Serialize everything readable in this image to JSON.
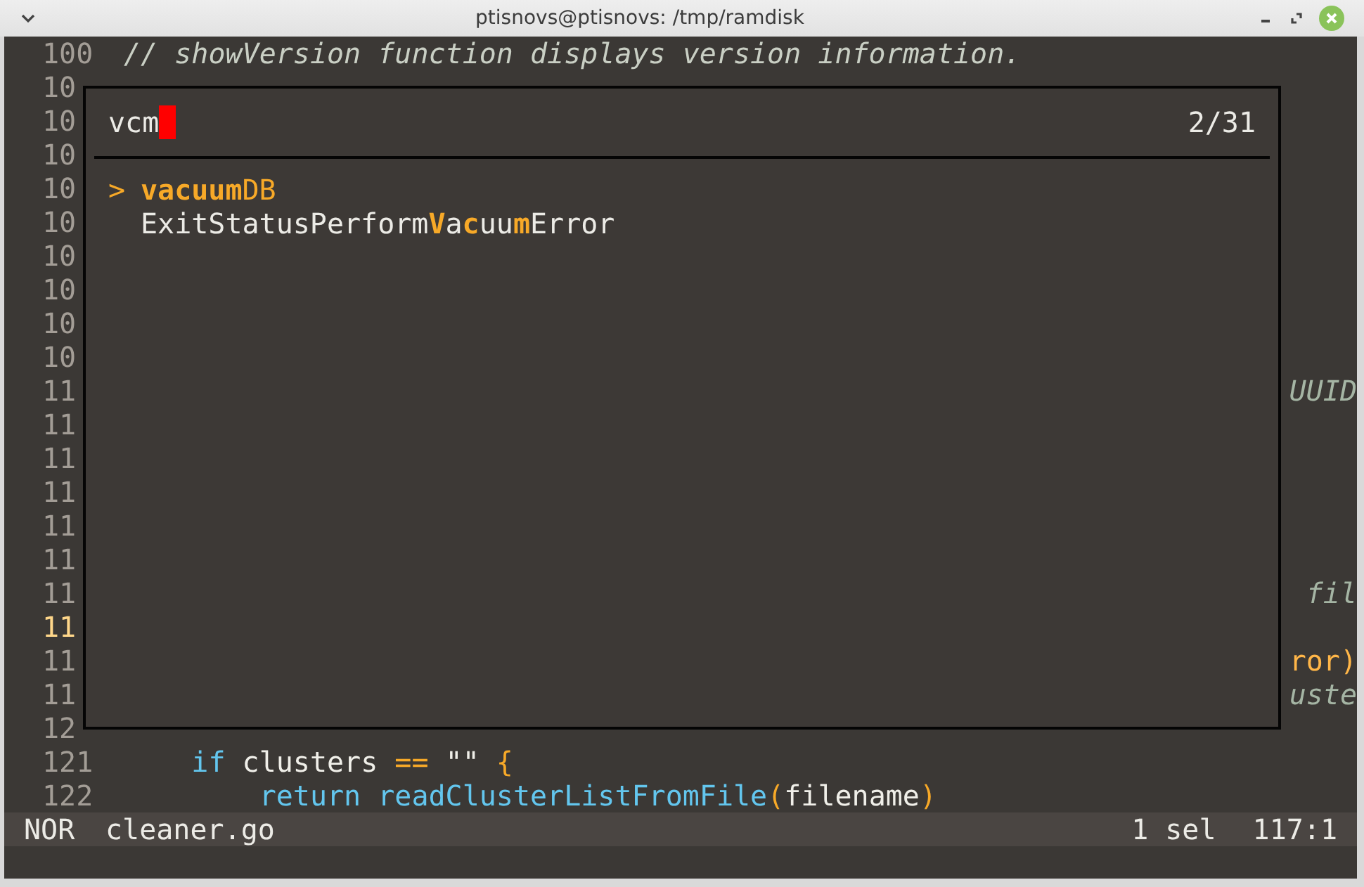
{
  "window": {
    "title": "ptisnovs@ptisnovs: /tmp/ramdisk"
  },
  "editor": {
    "lines": [
      {
        "number": "100",
        "current": false,
        "segments": [
          {
            "text": "// showVersion function displays version information.",
            "kind": "comment"
          }
        ]
      },
      {
        "number": "10",
        "current": false
      },
      {
        "number": "10",
        "current": false
      },
      {
        "number": "10",
        "current": false
      },
      {
        "number": "10",
        "current": false
      },
      {
        "number": "10",
        "current": false
      },
      {
        "number": "10",
        "current": false
      },
      {
        "number": "10",
        "current": false
      },
      {
        "number": "10",
        "current": false
      },
      {
        "number": "10",
        "current": false
      },
      {
        "number": "11",
        "current": false,
        "right": {
          "text": "UUID",
          "kind": "comment"
        }
      },
      {
        "number": "11",
        "current": false
      },
      {
        "number": "11",
        "current": false
      },
      {
        "number": "11",
        "current": false
      },
      {
        "number": "11",
        "current": false
      },
      {
        "number": "11",
        "current": false
      },
      {
        "number": "11",
        "current": false,
        "right": {
          "text": "fil",
          "kind": "comment"
        }
      },
      {
        "number": "11",
        "current": true
      },
      {
        "number": "11",
        "current": false,
        "right": {
          "text": "ror)",
          "kind": "operator"
        }
      },
      {
        "number": "11",
        "current": false,
        "right": {
          "text": "uste",
          "kind": "comment"
        }
      },
      {
        "number": "12",
        "current": false
      },
      {
        "number": "121",
        "current": false,
        "segments": [
          {
            "text": "    if",
            "kind": "keyword"
          },
          {
            "text": " clusters ",
            "kind": "plain"
          },
          {
            "text": "==",
            "kind": "operator"
          },
          {
            "text": " \"\"",
            "kind": "string"
          },
          {
            "text": " {",
            "kind": "operator"
          }
        ]
      },
      {
        "number": "122",
        "current": false,
        "segments": [
          {
            "text": "        return",
            "kind": "keyword"
          },
          {
            "text": " readClusterListFromFile",
            "kind": "function"
          },
          {
            "text": "(",
            "kind": "operator"
          },
          {
            "text": "filename",
            "kind": "plain"
          },
          {
            "text": ")",
            "kind": "operator"
          }
        ]
      }
    ]
  },
  "picker": {
    "query": "vcm",
    "count": "2/31",
    "pointer": ">",
    "results": [
      {
        "text": "**vacuum**DB",
        "selected": true
      },
      {
        "text": "ExitStatusPerform**V**a**c**uu**m**Error",
        "selected": false
      }
    ]
  },
  "status_bar": {
    "mode": "NOR",
    "file": "cleaner.go",
    "selection": "1 sel",
    "position": "117:1"
  }
}
